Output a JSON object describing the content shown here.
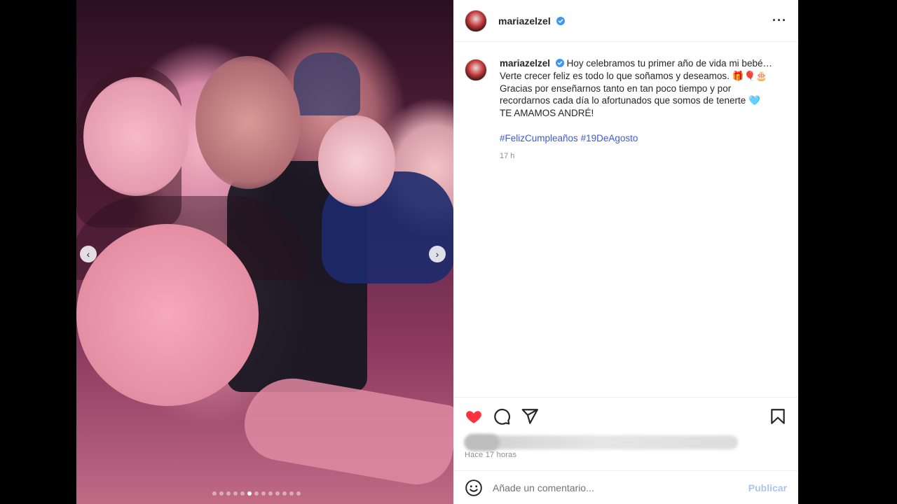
{
  "post": {
    "username": "mariazelzel",
    "caption": {
      "line1": "Hoy celebramos tu primer año de vida mi bebé…",
      "line2": "Verte crecer feliz es todo lo que soñamos y deseamos. 🎁🎈🎂",
      "line3": "Gracias por enseñarnos tanto en tan poco tiempo y por",
      "line4": "recordarnos cada día lo afortunados que somos de tenerte 🩵",
      "line5": "TE AMAMOS ANDRÉ!"
    },
    "hashtags": [
      "#FelizCumpleaños",
      "#19DeAgosto"
    ],
    "caption_time": "17 h",
    "time_ago": "Hace 17 horas",
    "carousel": {
      "total": 13,
      "active_index": 5
    }
  },
  "comment": {
    "placeholder": "Añade un comentario...",
    "publish_label": "Publicar"
  },
  "colors": {
    "like": "#ff3040",
    "verified": "#3897f0",
    "hashtag": "#3b5bd6",
    "publish_disabled": "#a9c4ee"
  },
  "icons": {
    "more": "more-options-icon",
    "like": "heart-icon",
    "comment": "comment-icon",
    "share": "send-icon",
    "save": "bookmark-icon",
    "emoji": "emoji-icon",
    "prev": "chevron-left-icon",
    "next": "chevron-right-icon"
  }
}
